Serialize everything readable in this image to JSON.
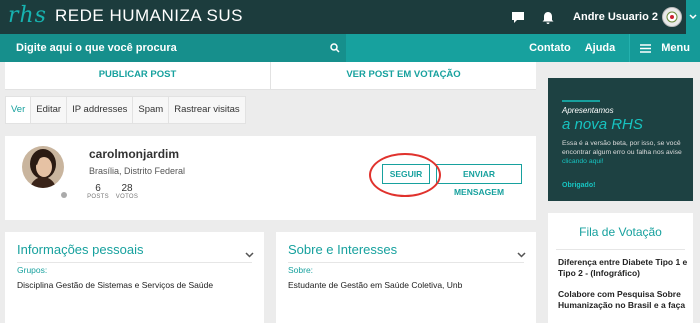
{
  "header": {
    "logo_mark": "rhs",
    "logo_text": "REDE HUMANIZA SUS",
    "user_name": "Andre Usuario 2"
  },
  "nav": {
    "search_placeholder": "Digite aqui o que você procura",
    "contato": "Contato",
    "ajuda": "Ajuda",
    "menu": "Menu"
  },
  "post_tabs": [
    "PUBLICAR POST",
    "VER POST EM VOTAÇÃO"
  ],
  "sub_tabs": [
    "Ver",
    "Editar",
    "IP addresses",
    "Spam",
    "Rastrear visitas"
  ],
  "profile": {
    "name": "carolmonjardim",
    "location": "Brasília, Distrito Federal",
    "posts_count": "6",
    "posts_label": "POSTS",
    "votes_count": "28",
    "votes_label": "VOTOS",
    "follow_label": "SEGUIR",
    "message_label": "ENVIAR MENSAGEM"
  },
  "personal_info": {
    "title": "Informações pessoais",
    "label": "Grupos:",
    "value": "Disciplina Gestão de Sistemas e Serviços de Saúde"
  },
  "interests": {
    "title": "Sobre e Interesses",
    "label": "Sobre:",
    "value": "Estudante de Gestão em Saúde Coletiva, Unb"
  },
  "promo": {
    "small": "Apresentamos",
    "big": "a nova RHS",
    "body": "Essa é a versão beta, por isso, se você encontrar algum erro ou falha nos avise",
    "link": "clicando aqui!",
    "thanks": "Obrigado!"
  },
  "queue": {
    "title": "Fila de Votação",
    "items": [
      "Diferença entre Diabete Tipo 1 e Tipo 2 - (Infográfico)",
      "Colabore com Pesquisa Sobre Humanização no Brasil e a faça"
    ]
  },
  "colors": {
    "teal": "#17a19e",
    "dark_header": "#1c3c3d",
    "highlight_circle": "#e0322d"
  }
}
